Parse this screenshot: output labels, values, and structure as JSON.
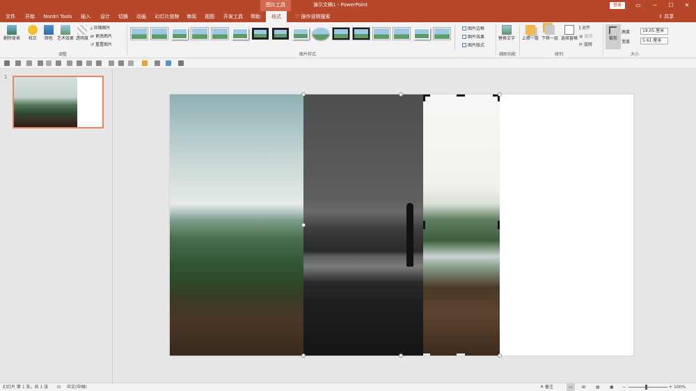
{
  "titlebar": {
    "context_tool": "图片工具",
    "doc_title": "演示文稿1  -  PowerPoint",
    "login": "登录",
    "minimize": "─",
    "maximize": "☐",
    "close": "✕"
  },
  "tabs": [
    "文件",
    "开始",
    "Nordri Tools",
    "插入",
    "设计",
    "切换",
    "动画",
    "幻灯片放映",
    "审阅",
    "视图",
    "开发工具",
    "帮助",
    "格式"
  ],
  "tell_me": "操作说明搜索",
  "share": "共享",
  "ribbon": {
    "adjust": {
      "remove_bg": "删除背景",
      "corrections": "校正",
      "color": "颜色",
      "artistic": "艺术效果",
      "transparency": "透明度",
      "compress": "压缩图片",
      "change": "更改图片",
      "reset": "重置图片",
      "label": "调整"
    },
    "styles": {
      "border": "图片边框",
      "effects": "图片效果",
      "layout": "图片版式",
      "label": "图片样式"
    },
    "accessibility": {
      "alt_text": "替换文字",
      "label": "辅助功能"
    },
    "arrange": {
      "forward": "上移一层",
      "backward": "下移一层",
      "selection_pane": "选择窗格",
      "align": "对齐",
      "group": "组合",
      "rotate": "旋转",
      "label": "排列"
    },
    "size": {
      "crop": "裁剪",
      "height_label": "高度",
      "height": "19.05 厘米",
      "width_label": "宽度",
      "width": "5.61 厘米",
      "label": "大小"
    }
  },
  "slides": {
    "number": "1"
  },
  "status": {
    "slide_info": "幻灯片 第 1 张，共 1 张",
    "language": "中文(中国)",
    "notes": "备注",
    "zoom": "100%"
  }
}
